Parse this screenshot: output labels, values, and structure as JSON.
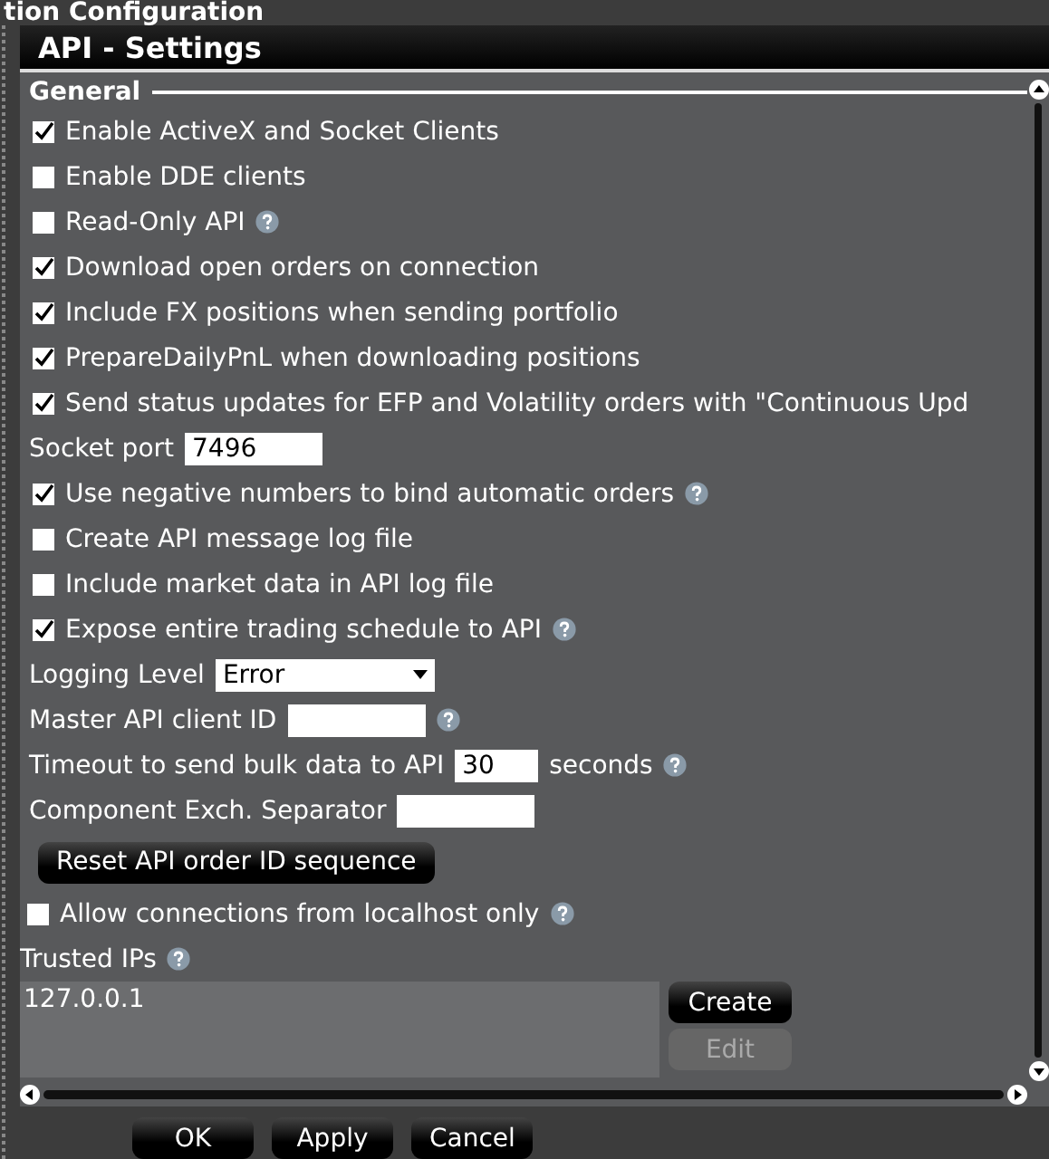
{
  "window": {
    "title": "tion Configuration"
  },
  "panel": {
    "title": "API - Settings"
  },
  "section": {
    "title": "General"
  },
  "items": [
    {
      "kind": "checkbox",
      "label": "Enable ActiveX and Socket Clients",
      "checked": true,
      "help": false
    },
    {
      "kind": "checkbox",
      "label": "Enable DDE clients",
      "checked": false,
      "help": false
    },
    {
      "kind": "checkbox",
      "label": "Read-Only API",
      "checked": false,
      "help": true
    },
    {
      "kind": "checkbox",
      "label": "Download open orders on connection",
      "checked": true,
      "help": false
    },
    {
      "kind": "checkbox",
      "label": "Include FX positions when sending portfolio",
      "checked": true,
      "help": false
    },
    {
      "kind": "checkbox",
      "label": "PrepareDailyPnL when downloading positions",
      "checked": true,
      "help": false
    },
    {
      "kind": "checkbox",
      "label": "Send status updates for EFP and Volatility orders with \"Continuous Upd",
      "checked": true,
      "help": false
    },
    {
      "kind": "field",
      "label": "Socket port",
      "value": "7496",
      "help": false
    },
    {
      "kind": "checkbox",
      "label": "Use negative numbers to bind automatic orders",
      "checked": true,
      "help": true
    },
    {
      "kind": "checkbox",
      "label": "Create API message log file",
      "checked": false,
      "help": false
    },
    {
      "kind": "checkbox",
      "label": "Include market data in API log file",
      "checked": false,
      "help": false
    },
    {
      "kind": "checkbox",
      "label": "Expose entire trading schedule to API",
      "checked": true,
      "help": true
    },
    {
      "kind": "select",
      "label": "Logging Level",
      "value": "Error",
      "help": false
    },
    {
      "kind": "field",
      "label": "Master API client ID",
      "value": "",
      "help": true
    },
    {
      "kind": "field",
      "label": "Timeout to send bulk data to API",
      "value": "30",
      "suffix": "seconds",
      "help": true
    },
    {
      "kind": "field",
      "label": "Component Exch. Separator",
      "value": "",
      "help": false
    },
    {
      "kind": "button",
      "label": "Reset API order ID sequence"
    },
    {
      "kind": "outer-checkbox",
      "label": "Allow connections from localhost only",
      "checked": false,
      "help": true
    }
  ],
  "trusted_ips": {
    "label": "Trusted IPs",
    "items": [
      "127.0.0.1"
    ],
    "buttons": [
      {
        "label": "Create",
        "disabled": false
      },
      {
        "label": "Edit",
        "disabled": true
      }
    ]
  },
  "buttons": [
    "OK",
    "Apply",
    "Cancel"
  ]
}
